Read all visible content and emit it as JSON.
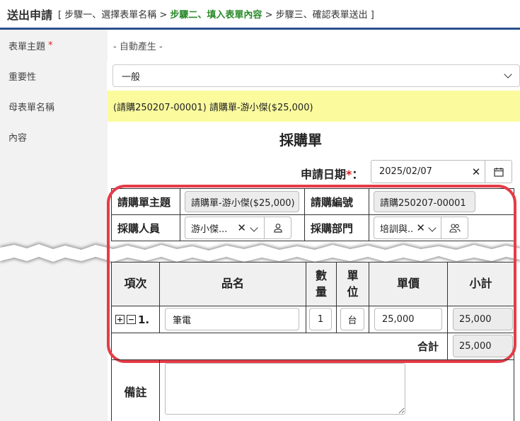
{
  "header": {
    "title": "送出申請",
    "step_open": "[ ",
    "step1": "步驟一、選擇表單名稱",
    "sep1": " > ",
    "step2": "步驟二、填入表單內容",
    "sep2": " > ",
    "step3": "步驟三、確認表單送出",
    "step_close": " ]"
  },
  "fields": {
    "subject_label": "表單主題",
    "subject_required": "*",
    "subject_value": "- 自動產生 -",
    "importance_label": "重要性",
    "importance_value": "一般",
    "parent_label": "母表單名稱",
    "parent_value": "(請購250207-00001) 請購單-游小傑($25,000)",
    "content_label": "內容"
  },
  "form": {
    "title": "採購單",
    "date_label": "申請日期",
    "date_required": "*",
    "date_colon": "：",
    "date_value": "2025/02/07",
    "pr_subject_label": "請購單主題",
    "pr_subject_value": "請購單-游小傑($25,000)",
    "pr_number_label": "請購編號",
    "pr_number_value": "請購250207-00001",
    "buyer_label": "採購人員",
    "buyer_value": "游小傑...",
    "dept_label": "採購部門",
    "dept_value": "培訓與..."
  },
  "items_table": {
    "headers": {
      "no": "項次",
      "name": "品名",
      "qty": "數\n量",
      "unit": "單\n位",
      "price": "單價",
      "subtotal": "小計"
    },
    "rows": [
      {
        "no": "1.",
        "name": "筆電",
        "qty": "1",
        "unit": "台",
        "price": "25,000",
        "subtotal": "25,000"
      }
    ],
    "total_label": "合計",
    "total_value": "25,000"
  },
  "memo_label": "備註",
  "colors": {
    "accent": "#2b4f8c",
    "highlight": "#fbfb9e",
    "frame": "#e53c48",
    "active_step": "#2a8a2a"
  }
}
